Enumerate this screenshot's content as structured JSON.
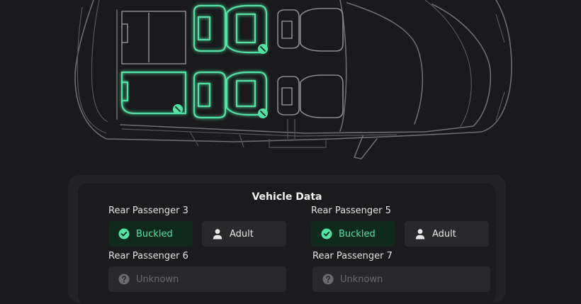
{
  "vehicle_data": {
    "title": "Vehicle Data",
    "passengers": [
      {
        "label": "Rear Passenger 3",
        "status": "Buckled",
        "occupant": "Adult"
      },
      {
        "label": "Rear Passenger 5",
        "status": "Buckled",
        "occupant": "Adult"
      },
      {
        "label": "Rear Passenger 6",
        "status": "Unknown"
      },
      {
        "label": "Rear Passenger 7",
        "status": "Unknown"
      }
    ]
  },
  "icons": {
    "buckled": "check-circle-icon",
    "adult": "person-icon",
    "unknown": "question-circle-icon"
  },
  "colors": {
    "accent": "#52e2a4",
    "background": "#1a1a1c",
    "panel": "#232325",
    "chip": "#29292b"
  }
}
